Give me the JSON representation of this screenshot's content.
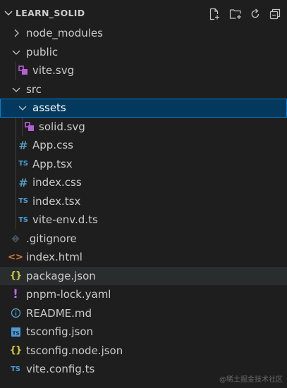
{
  "explorer": {
    "title": "LEARN_SOLID",
    "actions": [
      {
        "name": "new-file-icon"
      },
      {
        "name": "new-folder-icon"
      },
      {
        "name": "refresh-icon"
      },
      {
        "name": "collapse-all-icon"
      }
    ]
  },
  "tree": [
    {
      "label": "node_modules",
      "kind": "folder",
      "expanded": false
    },
    {
      "label": "public",
      "kind": "folder",
      "expanded": true
    },
    {
      "label": "vite.svg",
      "kind": "file",
      "icon": "svg-icon"
    },
    {
      "label": "src",
      "kind": "folder",
      "expanded": true
    },
    {
      "label": "assets",
      "kind": "folder",
      "expanded": true,
      "selected": true
    },
    {
      "label": "solid.svg",
      "kind": "file",
      "icon": "svg-icon"
    },
    {
      "label": "App.css",
      "kind": "file",
      "icon": "css-icon"
    },
    {
      "label": "App.tsx",
      "kind": "file",
      "icon": "typescript-icon"
    },
    {
      "label": "index.css",
      "kind": "file",
      "icon": "css-icon"
    },
    {
      "label": "index.tsx",
      "kind": "file",
      "icon": "typescript-icon"
    },
    {
      "label": "vite-env.d.ts",
      "kind": "file",
      "icon": "typescript-icon"
    },
    {
      "label": ".gitignore",
      "kind": "file",
      "icon": "git-icon"
    },
    {
      "label": "index.html",
      "kind": "file",
      "icon": "html-icon"
    },
    {
      "label": "package.json",
      "kind": "file",
      "icon": "json-icon",
      "hover": true
    },
    {
      "label": "pnpm-lock.yaml",
      "kind": "file",
      "icon": "yaml-icon"
    },
    {
      "label": "README.md",
      "kind": "file",
      "icon": "info-icon"
    },
    {
      "label": "tsconfig.json",
      "kind": "file",
      "icon": "tsconfig-icon"
    },
    {
      "label": "tsconfig.node.json",
      "kind": "file",
      "icon": "json-icon"
    },
    {
      "label": "vite.config.ts",
      "kind": "file",
      "icon": "typescript-icon"
    }
  ],
  "watermark": "@稀土掘金技术社区",
  "colors": {
    "selected_bg": "#04395e",
    "selected_border": "#007fd4",
    "hover_bg": "#2a2d2e",
    "svg_icon": "#b45fd6",
    "css_icon": "#519aba",
    "ts_icon": "#4d9ad6",
    "json_icon": "#cbcb41",
    "html_icon": "#e37933"
  }
}
